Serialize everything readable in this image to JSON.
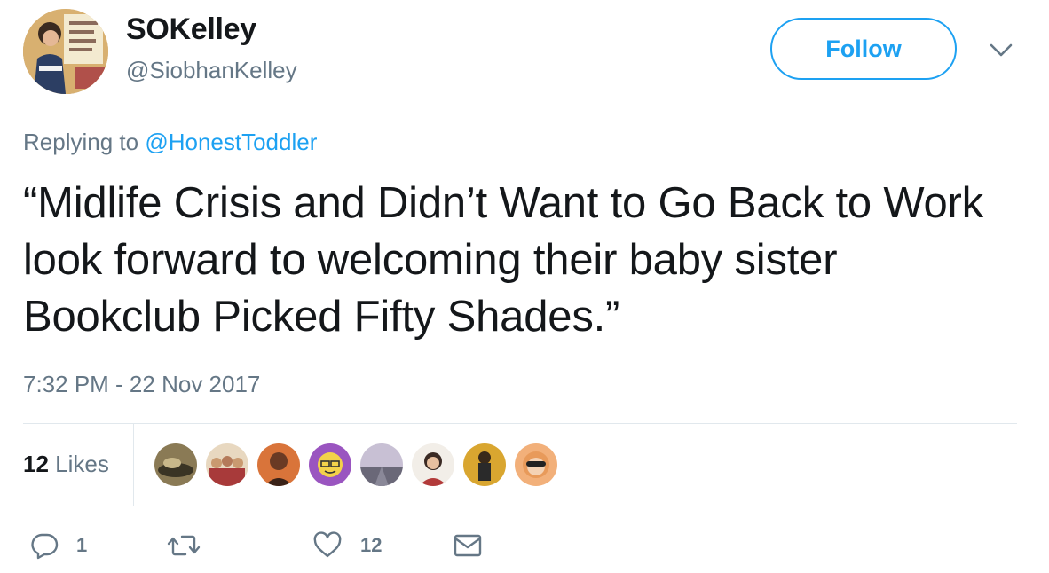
{
  "author": {
    "display_name": "SOKelley",
    "handle": "@SiobhanKelley",
    "avatar_icon": "profile-photo-icon"
  },
  "header": {
    "follow_label": "Follow",
    "menu_icon": "chevron-down-icon"
  },
  "reply": {
    "prefix": "Replying to ",
    "mention": "@HonestToddler"
  },
  "tweet": {
    "text": "“Midlife Crisis and Didn’t Want to Go Back to Work look forward to welcoming their baby sister Bookclub Picked Fifty Shades.”",
    "timestamp": "7:32 PM - 22 Nov 2017"
  },
  "stats": {
    "likes_count": "12",
    "likes_label": " Likes",
    "likers": [
      {
        "icon": "liker-avatar-1-icon",
        "color": "#6b5a3a"
      },
      {
        "icon": "liker-avatar-2-icon",
        "color": "#c9a070"
      },
      {
        "icon": "liker-avatar-3-icon",
        "color": "#c0603a"
      },
      {
        "icon": "liker-avatar-4-icon",
        "color": "#9a55c0"
      },
      {
        "icon": "liker-avatar-5-icon",
        "color": "#a8a6b8"
      },
      {
        "icon": "liker-avatar-6-icon",
        "color": "#b23a3a"
      },
      {
        "icon": "liker-avatar-7-icon",
        "color": "#d9a630"
      },
      {
        "icon": "liker-avatar-8-icon",
        "color": "#e07a3a"
      }
    ]
  },
  "actions": {
    "reply_count": "1",
    "retweet_count": "",
    "like_count": "12",
    "icons": [
      "reply-icon",
      "retweet-icon",
      "like-icon",
      "direct-message-icon"
    ]
  },
  "colors": {
    "accent": "#1da1f2",
    "text": "#14171a",
    "secondary": "#657786",
    "divider": "#e1e8ed"
  }
}
